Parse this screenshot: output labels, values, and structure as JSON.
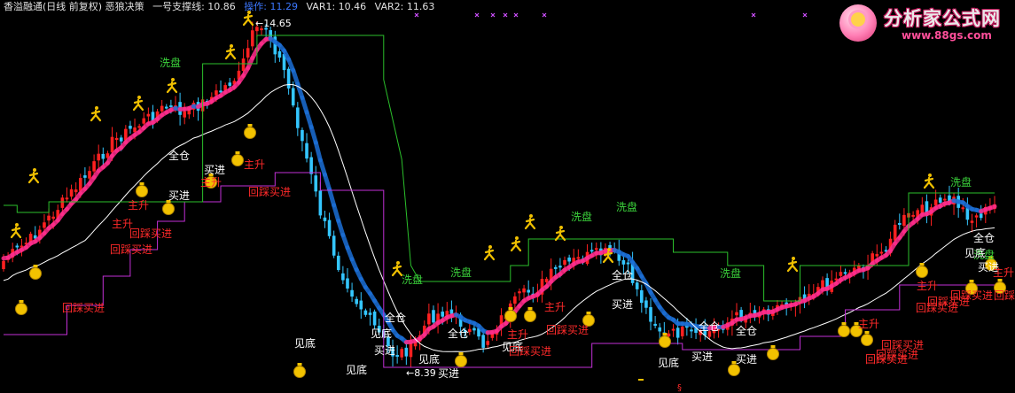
{
  "header": {
    "title": "香溢融通(日线 前复权) 恶狼决策",
    "support": "一号支撑线: 10.86",
    "op": "操作: 11.29",
    "var1": "VAR1: 10.46",
    "var2": "VAR2: 11.63"
  },
  "logo": {
    "name": "分析家公式网",
    "url": "www.88gs.com"
  },
  "colors": {
    "background": "#000000",
    "up": "#ff2020",
    "down": "#34c6ff",
    "ribbon_up": "#ff2d8c",
    "ribbon_down": "#1c6fd6",
    "ma_line": "#ffffff",
    "support_line": "#c22fd6",
    "resistance_line": "#2bbf2b",
    "signal_white": "#ffffff",
    "signal_red": "#ff2a2a",
    "signal_green": "#3bd33b",
    "bag": "#f2c200"
  },
  "chart_data": {
    "type": "candlestick",
    "title": "",
    "xlabel": "",
    "ylabel": "",
    "ylim": [
      8.3,
      15.0
    ],
    "grid": false,
    "peak_label": "14.65",
    "low_label": "8.39",
    "series": [
      {
        "name": "VAR2",
        "type": "line",
        "note": "白色均线"
      },
      {
        "name": "一号支撑线",
        "type": "step",
        "note": "紫色阶梯线"
      },
      {
        "name": "VAR1",
        "type": "step",
        "note": "绿色阶梯线"
      }
    ],
    "annotations": [
      {
        "label": "洗盘",
        "color": "green"
      },
      {
        "label": "洗盘",
        "color": "green"
      },
      {
        "label": "洗盘",
        "color": "green"
      },
      {
        "label": "洗盘",
        "color": "green"
      },
      {
        "label": "洗盘",
        "color": "green"
      },
      {
        "label": "洗盘",
        "color": "green"
      },
      {
        "label": "洗盘",
        "color": "green"
      },
      {
        "label": "洗盘",
        "color": "green"
      },
      {
        "label": "全仓",
        "color": "white"
      },
      {
        "label": "全仓",
        "color": "white"
      },
      {
        "label": "全仓",
        "color": "white"
      },
      {
        "label": "全仓",
        "color": "white"
      },
      {
        "label": "全仓",
        "color": "white"
      },
      {
        "label": "全仓",
        "color": "white"
      },
      {
        "label": "全仓",
        "color": "white"
      },
      {
        "label": "买进",
        "color": "white"
      },
      {
        "label": "买进",
        "color": "white"
      },
      {
        "label": "买进",
        "color": "white"
      },
      {
        "label": "买进",
        "color": "white"
      },
      {
        "label": "买进",
        "color": "white"
      },
      {
        "label": "买进",
        "color": "white"
      },
      {
        "label": "买进",
        "color": "white"
      },
      {
        "label": "买进",
        "color": "white"
      },
      {
        "label": "见底",
        "color": "white"
      },
      {
        "label": "见底",
        "color": "white"
      },
      {
        "label": "见底",
        "color": "white"
      },
      {
        "label": "见底",
        "color": "white"
      },
      {
        "label": "见底",
        "color": "white"
      },
      {
        "label": "见底",
        "color": "white"
      },
      {
        "label": "见底",
        "color": "white"
      },
      {
        "label": "主升",
        "color": "red"
      },
      {
        "label": "主升",
        "color": "red"
      },
      {
        "label": "主升",
        "color": "red"
      },
      {
        "label": "主升",
        "color": "red"
      },
      {
        "label": "主升",
        "color": "red"
      },
      {
        "label": "主升",
        "color": "red"
      },
      {
        "label": "主升",
        "color": "red"
      },
      {
        "label": "主升",
        "color": "red"
      },
      {
        "label": "主升",
        "color": "red"
      },
      {
        "label": "回踩买进",
        "color": "red"
      },
      {
        "label": "回踩买进",
        "color": "red"
      },
      {
        "label": "回踩买进",
        "color": "red"
      },
      {
        "label": "回踩买进",
        "color": "red"
      },
      {
        "label": "回踩买进",
        "color": "red"
      },
      {
        "label": "回踩买进",
        "color": "red"
      },
      {
        "label": "回踩买进",
        "color": "red"
      },
      {
        "label": "回踩买进",
        "color": "red"
      },
      {
        "label": "回踩买进",
        "color": "red"
      },
      {
        "label": "回踩买进",
        "color": "red"
      },
      {
        "label": "回踩买进",
        "color": "red"
      },
      {
        "label": "回踩买进",
        "color": "red"
      },
      {
        "label": "回踩买进",
        "color": "red"
      }
    ]
  }
}
